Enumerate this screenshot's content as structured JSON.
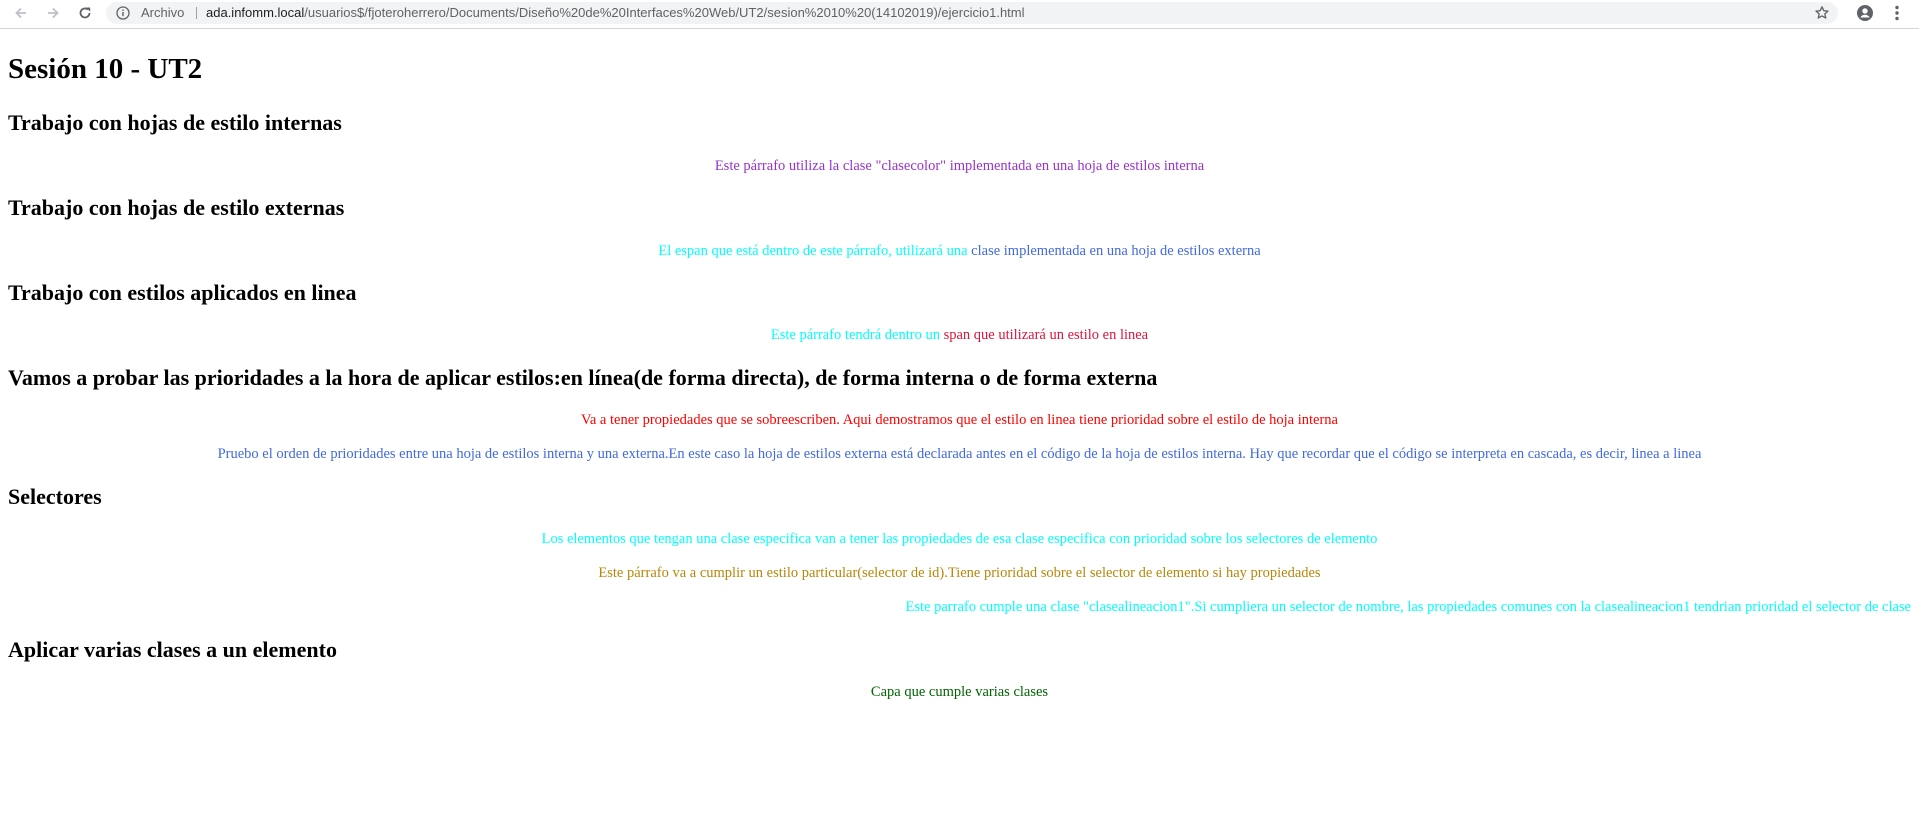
{
  "browser": {
    "archivo_label": "Archivo",
    "url_host": "ada.infomm.local",
    "url_path": "/usuarios$/fjoteroherrero/Documents/Diseño%20de%20Interfaces%20Web/UT2/sesion%2010%20(14102019)/ejercicio1.html",
    "icons": [
      "back-icon",
      "forward-icon",
      "reload-icon",
      "info-icon",
      "star-icon",
      "account-icon",
      "menu-icon"
    ]
  },
  "page": {
    "title": "Sesión 10 - UT2",
    "sections": [
      {
        "heading": "Trabajo con hojas de estilo internas",
        "paragraph": "Este párrafo utiliza la clase \"clasecolor\" implementada en una hoja de estilos interna"
      },
      {
        "heading": "Trabajo con hojas de estilo externas",
        "paragraph_part1": "El espan que está dentro de este párrafo, utilizará una ",
        "paragraph_span": "clase implementada en una hoja de estilos externa"
      },
      {
        "heading": "Trabajo con estilos aplicados en linea",
        "paragraph_part1": "Este párrafo tendrá dentro un ",
        "paragraph_span": "span que utilizará un estilo en linea"
      },
      {
        "heading": "Vamos a probar las prioridades a la hora de aplicar estilos:en línea(de forma directa), de forma interna o de forma externa",
        "paragraph1": "Va a tener propiedades que se sobreescriben. Aqui demostramos que el estilo en linea tiene prioridad sobre el estilo de hoja interna",
        "paragraph2": "Pruebo el orden de prioridades entre una hoja de estilos interna y una externa.En este caso la hoja de estilos externa está declarada antes en el código de la hoja de estilos interna. Hay que recordar que el código se interpreta en cascada, es decir, linea a linea"
      },
      {
        "heading": "Selectores",
        "paragraph1": "Los elementos que tengan una clase especifica van a tener las propiedades de esa clase especifica con prioridad sobre los selectores de elemento",
        "paragraph2": "Este párrafo va a cumplir un estilo particular(selector de id).Tiene prioridad sobre el selector de elemento si hay propiedades",
        "paragraph3": "Este parrafo cumple una clase \"clasealineacion1\".Si cumpliera un selector de nombre, las propiedades comunes con la clasealineacion1 tendrian prioridad el selector de clase"
      },
      {
        "heading": "Aplicar varias clases a un elemento",
        "paragraph": "Capa que cumple varias clases"
      }
    ]
  },
  "colors": {
    "purple": "#9932cc",
    "cyan": "#00ffff",
    "royal_blue": "#4169e1",
    "crimson": "#dc143c",
    "red": "#ff0000",
    "ochre": "#b8860b",
    "dark_green": "#006400"
  }
}
